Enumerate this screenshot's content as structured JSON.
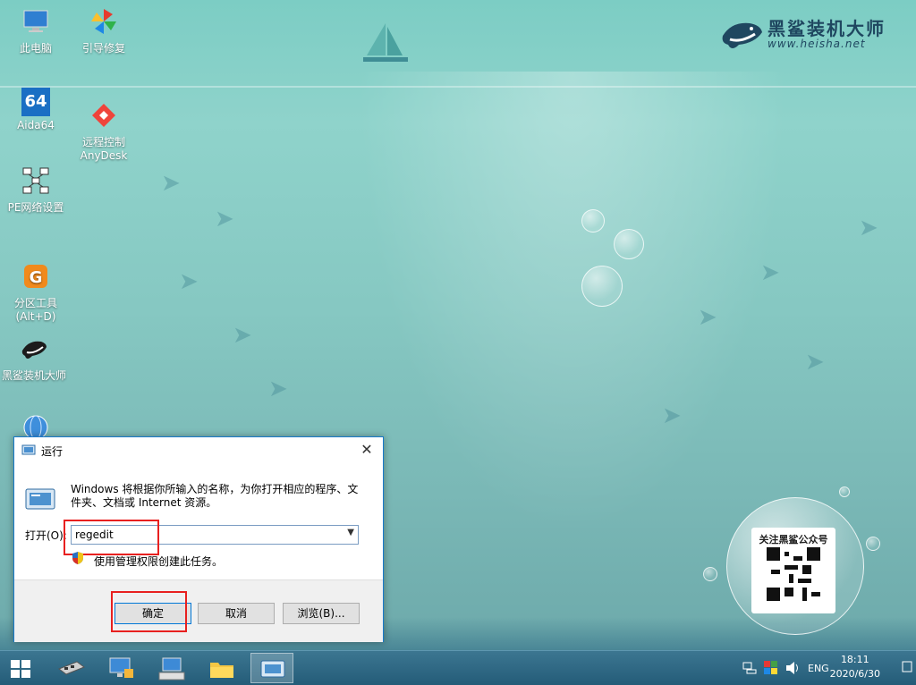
{
  "desktop": {
    "icons": [
      {
        "label": "此电脑"
      },
      {
        "label": "引导修复"
      },
      {
        "label": "Aida64"
      },
      {
        "label": "远程控制\nAnyDesk"
      },
      {
        "label": "PE网络设置"
      },
      {
        "label": "分区工具\n(Alt+D)"
      },
      {
        "label": "黑鲨装机大师"
      }
    ],
    "aida_badge": "64"
  },
  "logo": {
    "name": "黑鲨装机大师",
    "url": "www.heisha.net"
  },
  "qr": {
    "caption": "关注黑鲨公众号"
  },
  "run_dialog": {
    "title": "运行",
    "close_glyph": "✕",
    "description": "Windows 将根据你所输入的名称，为你打开相应的程序、文件夹、文档或 Internet 资源。",
    "open_label": "打开(O):",
    "command_value": "regedit",
    "admin_note": "使用管理权限创建此任务。",
    "buttons": {
      "ok": "确定",
      "cancel": "取消",
      "browse": "浏览(B)..."
    }
  },
  "taskbar": {
    "language": "ENG",
    "time": "18:11",
    "date": "2020/6/30"
  },
  "colors": {
    "highlight": "#e8201f",
    "accent": "#0078d7"
  }
}
